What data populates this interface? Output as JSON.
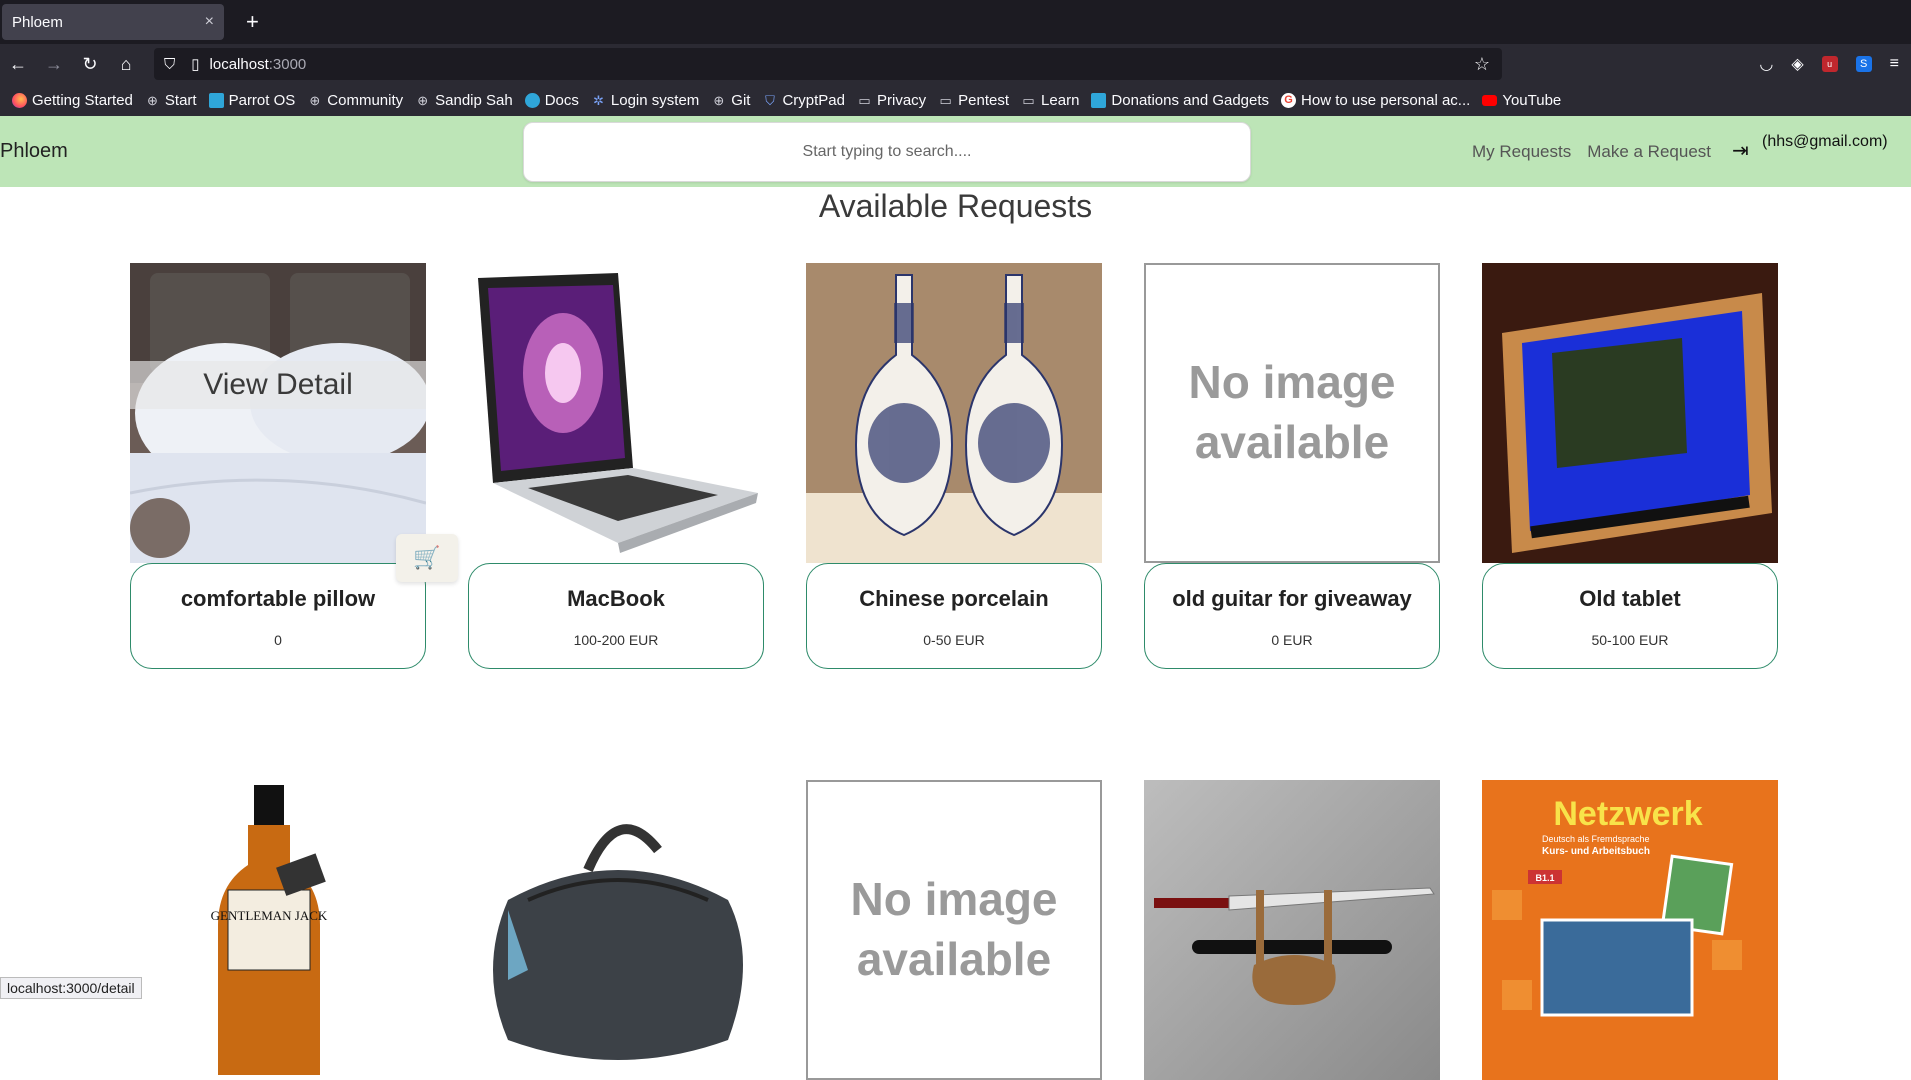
{
  "browser": {
    "tab_title": "Phloem",
    "tab_close": "×",
    "new_tab": "+",
    "url_host": "localhost",
    "url_port": ":3000",
    "bookmarks": [
      {
        "label": "Getting Started",
        "icon": "firefox-icon"
      },
      {
        "label": "Start",
        "icon": "globe-icon"
      },
      {
        "label": "Parrot OS",
        "icon": "parrot-icon"
      },
      {
        "label": "Community",
        "icon": "globe-icon"
      },
      {
        "label": "Sandip Sah",
        "icon": "globe-icon"
      },
      {
        "label": "Docs",
        "icon": "docs-icon"
      },
      {
        "label": "Login system",
        "icon": "gear-icon"
      },
      {
        "label": "Git",
        "icon": "globe-icon"
      },
      {
        "label": "CryptPad",
        "icon": "shield-icon"
      },
      {
        "label": "Privacy",
        "icon": "folder-icon"
      },
      {
        "label": "Pentest",
        "icon": "folder-icon"
      },
      {
        "label": "Learn",
        "icon": "folder-icon"
      },
      {
        "label": "Donations and Gadgets",
        "icon": "parrot-icon"
      },
      {
        "label": "How to use personal ac...",
        "icon": "google-icon"
      },
      {
        "label": "YouTube",
        "icon": "youtube-icon"
      }
    ],
    "status_url": "localhost:3000/detail"
  },
  "app": {
    "brand": "Phloem",
    "search_placeholder": "Start typing to search....",
    "nav": {
      "my_requests": "My Requests",
      "make_request": "Make a Request"
    },
    "user_email": "(hhs@gmail.com)",
    "section_title": "Available Requests",
    "hover_overlay": "View Detail",
    "no_image_text": "No image available",
    "items": [
      {
        "name": "comfortable pillow",
        "price": "0",
        "image": "pillow"
      },
      {
        "name": "MacBook",
        "price": "100-200 EUR",
        "image": "macbook"
      },
      {
        "name": "Chinese porcelain",
        "price": "0-50 EUR",
        "image": "vases"
      },
      {
        "name": "old guitar for giveaway",
        "price": "0 EUR",
        "image": "none"
      },
      {
        "name": "Old tablet",
        "price": "50-100 EUR",
        "image": "tablet"
      },
      {
        "name": "",
        "price": "",
        "image": "whiskey"
      },
      {
        "name": "",
        "price": "",
        "image": "bag"
      },
      {
        "name": "",
        "price": "",
        "image": "none"
      },
      {
        "name": "",
        "price": "",
        "image": "katana"
      },
      {
        "name": "",
        "price": "",
        "image": "book"
      }
    ],
    "bottle_label": "GENTLEMAN JACK",
    "book_title": "Netzwerk",
    "book_sub": "Deutsch als Fremdsprache",
    "book_sub2": "Kurs- und Arbeitsbuch",
    "book_level": "B1.1"
  }
}
